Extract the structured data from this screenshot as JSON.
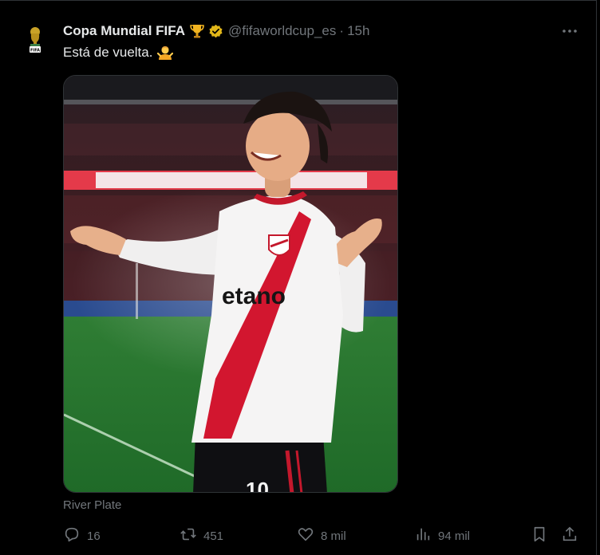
{
  "account": {
    "name": "Copa Mundial FIFA",
    "handle": "@fifaworldcup_es",
    "separator": "·",
    "time": "15h",
    "avatar_text": "FIFA"
  },
  "tweet": {
    "text": "Está de vuelta."
  },
  "media": {
    "sponsor_text": "etano",
    "shirt_number": "10"
  },
  "source_label": "River Plate",
  "actions": {
    "replies": "16",
    "reposts": "451",
    "likes": "8 mil",
    "views": "94 mil"
  },
  "icons": {
    "trophy": "trophy-icon",
    "verified": "verified-badge-icon",
    "emoji": "person-shrugging-icon",
    "more": "more-horizontal-icon",
    "reply": "reply-icon",
    "repost": "repost-icon",
    "like": "like-icon",
    "views": "views-icon",
    "bookmark": "bookmark-icon",
    "share": "share-icon"
  },
  "colors": {
    "background": "#000000",
    "text": "#e7e9ea",
    "muted": "#71767b",
    "verified_gold": "#e2b719"
  }
}
